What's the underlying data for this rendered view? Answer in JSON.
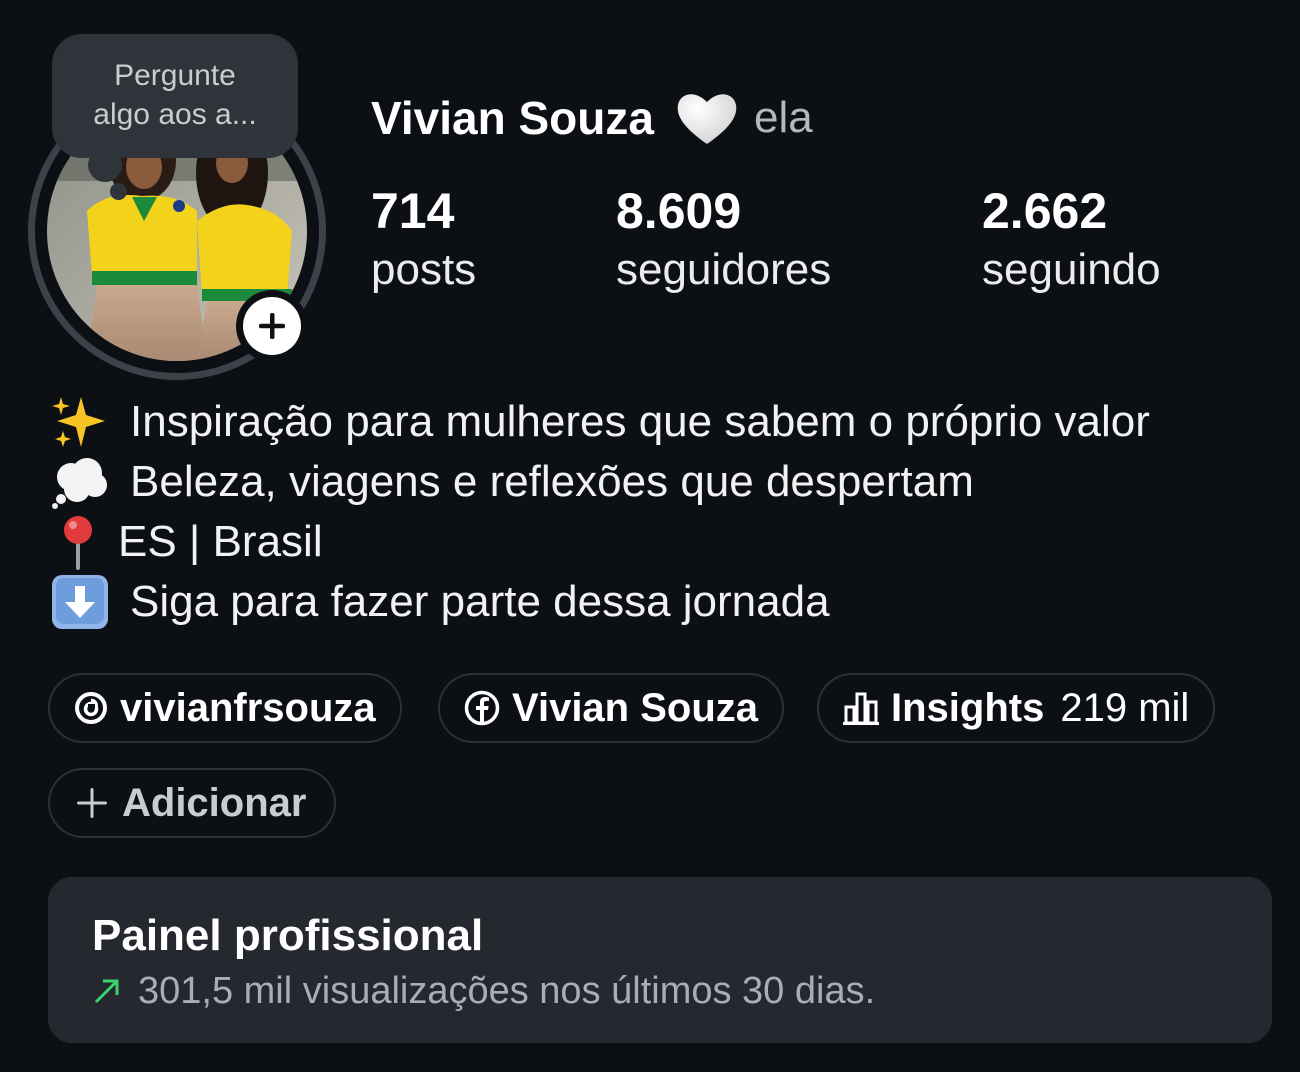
{
  "note": {
    "line1": "Pergunte",
    "line2": "algo aos a..."
  },
  "profile": {
    "name": "Vivian Souza",
    "name_icon": "white-heart-icon",
    "pronouns": "ela"
  },
  "stats": [
    {
      "value": "714",
      "label": "posts"
    },
    {
      "value": "8.609",
      "label": "seguidores"
    },
    {
      "value": "2.662",
      "label": "seguindo"
    }
  ],
  "bio": [
    {
      "icon": "sparkles-emoji",
      "text": "Inspiração para mulheres que sabem o próprio valor"
    },
    {
      "icon": "thought-balloon-emoji",
      "text": "Beleza, viagens e reflexões que despertam"
    },
    {
      "icon": "round-pushpin-emoji",
      "text": "ES | Brasil"
    },
    {
      "icon": "down-arrow-emoji",
      "text": "Siga para fazer parte dessa jornada"
    }
  ],
  "chips": {
    "threads": {
      "icon": "threads-icon",
      "label": "vivianfrsouza"
    },
    "facebook": {
      "icon": "facebook-icon",
      "label": "Vivian Souza"
    },
    "insights": {
      "icon": "bar-chart-icon",
      "label": "Insights",
      "value": "219 mil"
    },
    "add": {
      "icon": "plus-icon",
      "label": "Adicionar"
    }
  },
  "panel": {
    "title": "Painel profissional",
    "subtitle": "301,5 mil visualizações nos últimos 30 dias.",
    "trend_icon": "trend-up-arrow-icon"
  },
  "colors": {
    "background": "#0c0f14",
    "panel": "#25282e",
    "chip_border": "#2c3037",
    "trend_green": "#3bd16f",
    "jersey_yellow": "#f2d21b"
  }
}
